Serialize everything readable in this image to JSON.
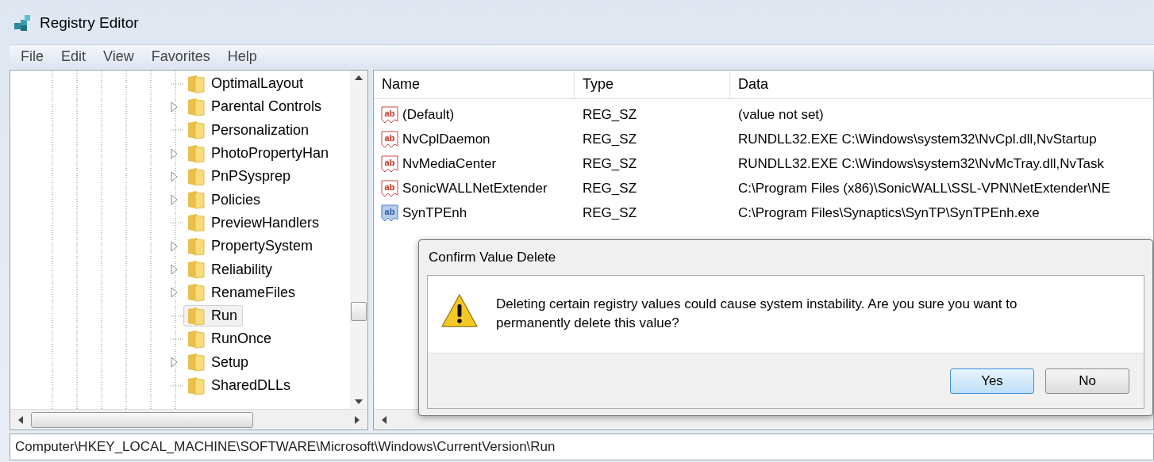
{
  "window": {
    "title": "Registry Editor"
  },
  "menu": [
    "File",
    "Edit",
    "View",
    "Favorites",
    "Help"
  ],
  "tree": {
    "items": [
      {
        "label": "OptimalLayout",
        "expandable": false,
        "selected": false
      },
      {
        "label": "Parental Controls",
        "expandable": true,
        "selected": false
      },
      {
        "label": "Personalization",
        "expandable": false,
        "selected": false
      },
      {
        "label": "PhotoPropertyHan",
        "expandable": true,
        "selected": false
      },
      {
        "label": "PnPSysprep",
        "expandable": true,
        "selected": false
      },
      {
        "label": "Policies",
        "expandable": true,
        "selected": false
      },
      {
        "label": "PreviewHandlers",
        "expandable": false,
        "selected": false
      },
      {
        "label": "PropertySystem",
        "expandable": true,
        "selected": false
      },
      {
        "label": "Reliability",
        "expandable": true,
        "selected": false
      },
      {
        "label": "RenameFiles",
        "expandable": true,
        "selected": false
      },
      {
        "label": "Run",
        "expandable": false,
        "selected": true
      },
      {
        "label": "RunOnce",
        "expandable": false,
        "selected": false
      },
      {
        "label": "Setup",
        "expandable": true,
        "selected": false
      },
      {
        "label": "SharedDLLs",
        "expandable": false,
        "selected": false
      }
    ]
  },
  "table": {
    "columns": [
      "Name",
      "Type",
      "Data"
    ],
    "rows": [
      {
        "icon": "ab",
        "name": "(Default)",
        "type": "REG_SZ",
        "data": "(value not set)",
        "selected": false
      },
      {
        "icon": "ab",
        "name": "NvCplDaemon",
        "type": "REG_SZ",
        "data": "RUNDLL32.EXE C:\\Windows\\system32\\NvCpl.dll,NvStartup",
        "selected": false
      },
      {
        "icon": "ab",
        "name": "NvMediaCenter",
        "type": "REG_SZ",
        "data": "RUNDLL32.EXE C:\\Windows\\system32\\NvMcTray.dll,NvTask",
        "selected": false
      },
      {
        "icon": "ab",
        "name": "SonicWALLNetExtender",
        "type": "REG_SZ",
        "data": "C:\\Program Files (x86)\\SonicWALL\\SSL-VPN\\NetExtender\\NE",
        "selected": false
      },
      {
        "icon": "ab",
        "name": "SynTPEnh",
        "type": "REG_SZ",
        "data": "C:\\Program Files\\Synaptics\\SynTP\\SynTPEnh.exe",
        "selected": true
      }
    ]
  },
  "dialog": {
    "title": "Confirm Value Delete",
    "message": "Deleting certain registry values could cause system instability. Are you sure you want to permanently delete this value?",
    "buttons": [
      {
        "label": "Yes",
        "selected": true
      },
      {
        "label": "No",
        "selected": false
      }
    ]
  },
  "status_bar": "Computer\\HKEY_LOCAL_MACHINE\\SOFTWARE\\Microsoft\\Windows\\CurrentVersion\\Run"
}
